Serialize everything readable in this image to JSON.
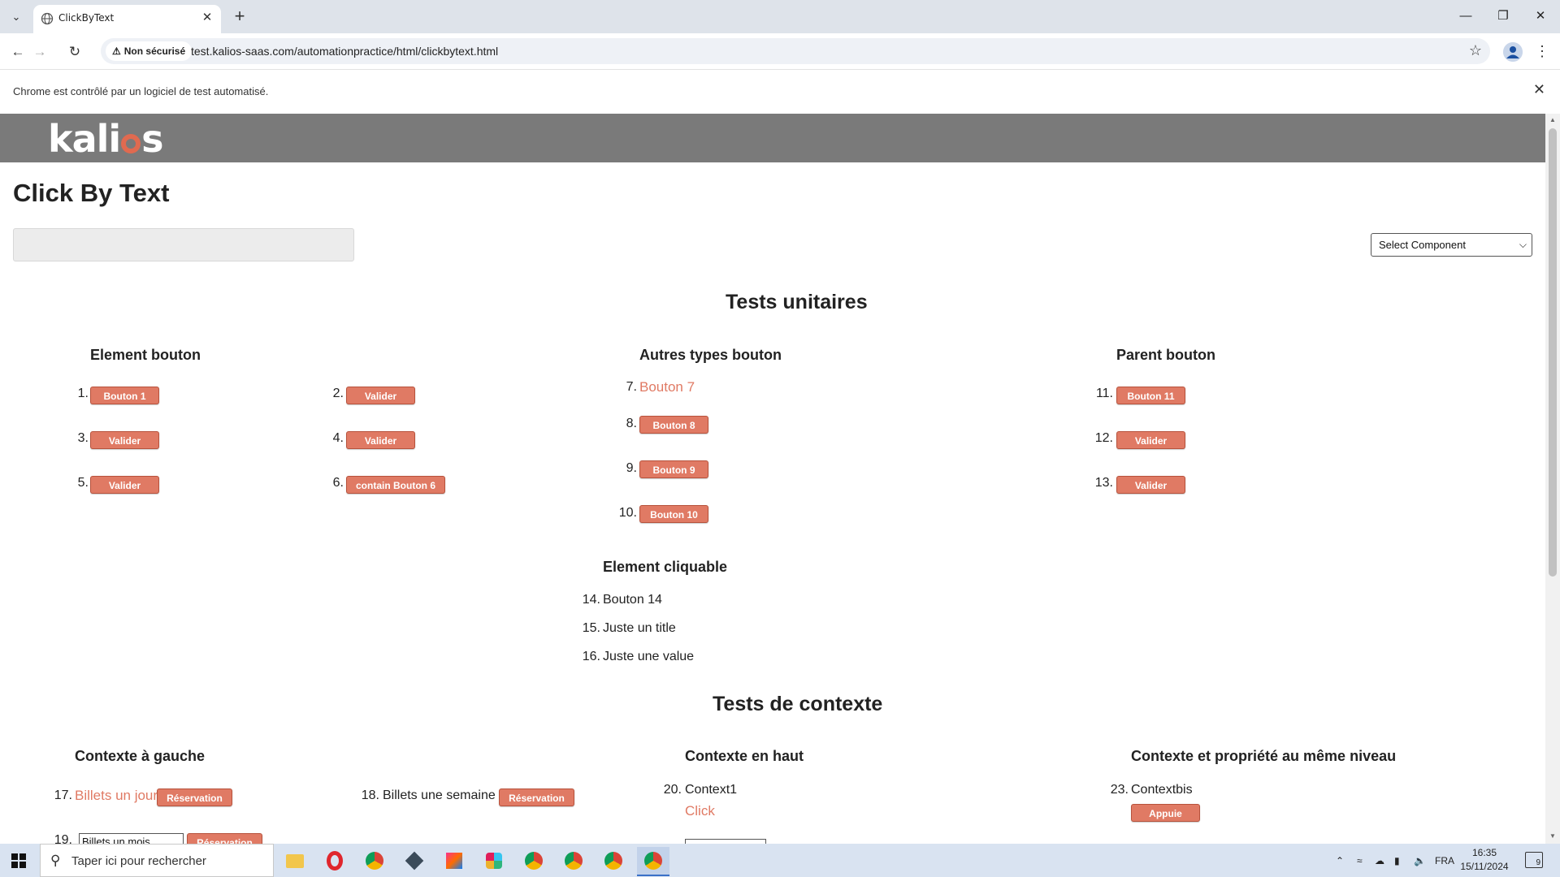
{
  "browser": {
    "tab_title": "ClickByText",
    "security_label": "Non sécurisé",
    "url": "test.kalios-saas.com/automationpractice/html/clickbytext.html",
    "infobar_text": "Chrome est contrôlé par un logiciel de test automatisé."
  },
  "page": {
    "logo_left": "kali",
    "logo_right": "s",
    "title": "Click By Text",
    "select_value": "Select Component",
    "unit_tests_heading": "Tests unitaires",
    "context_tests_heading": "Tests de contexte"
  },
  "element_bouton": {
    "heading": "Element bouton",
    "items": [
      {
        "num": "1.",
        "label": "Bouton 1"
      },
      {
        "num": "2.",
        "label": "Valider"
      },
      {
        "num": "3.",
        "label": "Valider"
      },
      {
        "num": "4.",
        "label": "Valider"
      },
      {
        "num": "5.",
        "label": "Valider"
      },
      {
        "num": "6.",
        "label": "contain Bouton 6"
      }
    ]
  },
  "autres_types": {
    "heading": "Autres types bouton",
    "items": [
      {
        "num": "7.",
        "label": "Bouton 7"
      },
      {
        "num": "8.",
        "label": "Bouton 8"
      },
      {
        "num": "9.",
        "label": "Bouton 9"
      },
      {
        "num": "10.",
        "label": "Bouton 10"
      }
    ]
  },
  "parent_bouton": {
    "heading": "Parent bouton",
    "items": [
      {
        "num": "11.",
        "label": "Bouton 11"
      },
      {
        "num": "12.",
        "label": "Valider"
      },
      {
        "num": "13.",
        "label": "Valider"
      }
    ]
  },
  "element_cliquable": {
    "heading": "Element cliquable",
    "items": [
      {
        "num": "14.",
        "label": "Bouton 14"
      },
      {
        "num": "15.",
        "label": "Juste un title"
      },
      {
        "num": "16.",
        "label": "Juste une value"
      }
    ]
  },
  "contexte_gauche": {
    "heading": "Contexte à gauche",
    "item17_num": "17.",
    "item17_link": "Billets un jour",
    "item17_button": "Réservation",
    "item18_num": "18.",
    "item18_text": "Billets une semaine",
    "item18_button": "Réservation",
    "item19_num": "19.",
    "item19_input": "Billets un mois",
    "item19_button": "Réservation"
  },
  "contexte_haut": {
    "heading": "Contexte en haut",
    "item20_num": "20.",
    "item20_text": "Context1",
    "item20_link": "Click"
  },
  "contexte_meme_niveau": {
    "heading": "Contexte et propriété au même niveau",
    "item23_num": "23.",
    "item23_text": "Contextbis",
    "item23_button": "Appuie"
  },
  "taskbar": {
    "search_placeholder": "Taper ici pour rechercher",
    "language": "FRA",
    "time": "16:35",
    "date": "15/11/2024",
    "notification_count": "9"
  },
  "colors": {
    "accent": "#e07a64",
    "header_bg": "#7a7a7a"
  }
}
